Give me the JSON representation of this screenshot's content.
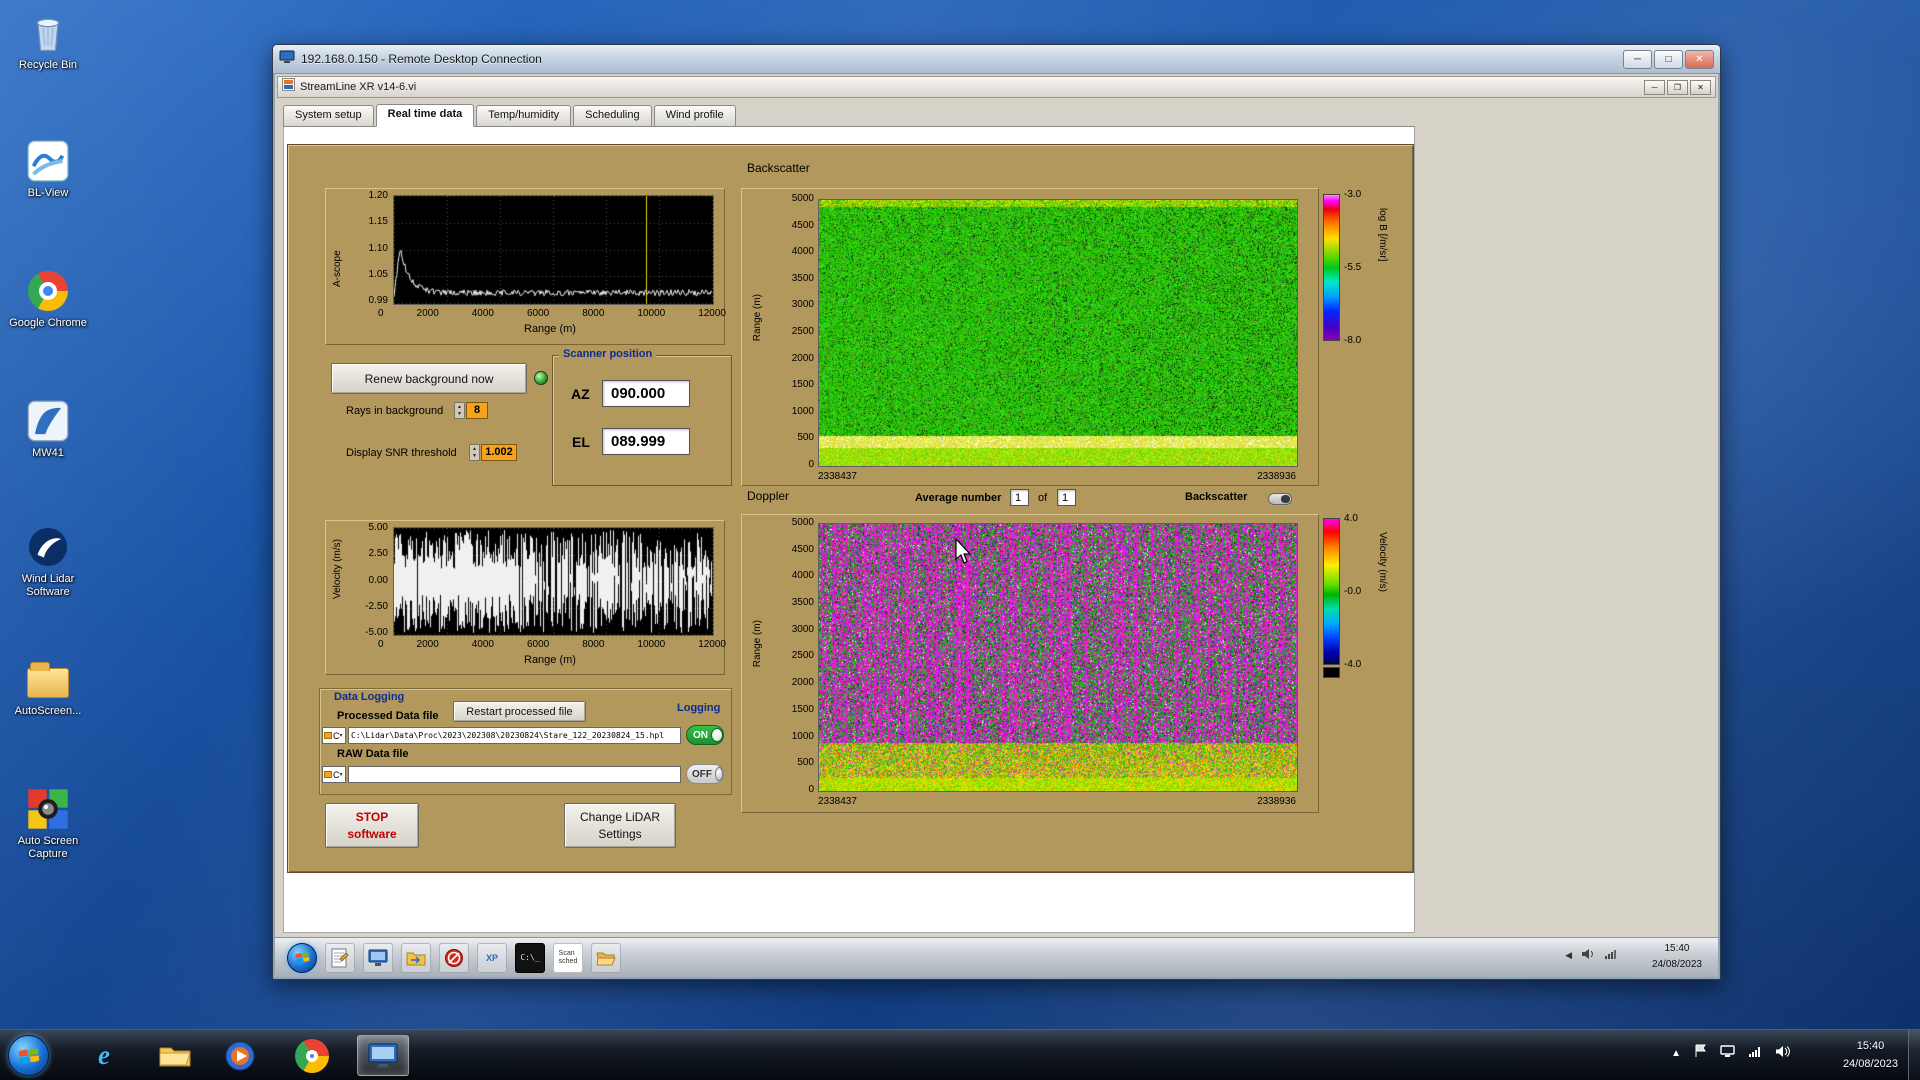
{
  "desktop": {
    "icons": [
      {
        "label": "Recycle Bin"
      },
      {
        "label": "BL-View"
      },
      {
        "label": "Google Chrome"
      },
      {
        "label": "MW41"
      },
      {
        "label": "Wind Lidar Software"
      },
      {
        "label": "AutoScreen..."
      },
      {
        "label": "Auto Screen Capture"
      }
    ]
  },
  "rdp": {
    "title": "192.168.0.150 - Remote Desktop Connection"
  },
  "app": {
    "title": "StreamLine XR v14-6.vi",
    "tabs": [
      {
        "label": "System setup"
      },
      {
        "label": "Real time data"
      },
      {
        "label": "Temp/humidity"
      },
      {
        "label": "Scheduling"
      },
      {
        "label": "Wind profile"
      }
    ]
  },
  "controls": {
    "renew_background": "Renew background now",
    "rays_label": "Rays in background",
    "rays_value": "8",
    "snr_label": "Display SNR threshold",
    "snr_value": "1.002",
    "scanner": {
      "title": "Scanner position",
      "az_label": "AZ",
      "az": "090.000",
      "el_label": "EL",
      "el": "089.999"
    },
    "average": {
      "label": "Average number",
      "value": "1",
      "of": "of",
      "value2": "1"
    },
    "backscatter_toggle_label": "Backscatter"
  },
  "plots": {
    "ascope": {
      "ylabel": "A-scope",
      "yticks": [
        "1.20",
        "1.15",
        "1.10",
        "1.05",
        "0.99"
      ],
      "xticks": [
        "0",
        "2000",
        "4000",
        "6000",
        "8000",
        "10000",
        "12000"
      ],
      "xlabel": "Range (m)"
    },
    "velocity_scope": {
      "ylabel": "Velocity (m/s)",
      "yticks": [
        "5.00",
        "2.50",
        "0.00",
        "-2.50",
        "-5.00"
      ],
      "xticks": [
        "0",
        "2000",
        "4000",
        "6000",
        "8000",
        "10000",
        "12000"
      ],
      "xlabel": "Range (m)"
    },
    "backscatter": {
      "title": "Backscatter",
      "ylabel": "Range (m)",
      "yticks": [
        "5000",
        "4500",
        "4000",
        "3500",
        "3000",
        "2500",
        "2000",
        "1500",
        "1000",
        "500",
        "0"
      ],
      "x_start": "2338437",
      "x_end": "2338936",
      "colorbar": {
        "ticks": [
          "-3.0",
          "-5.5",
          "-8.0"
        ],
        "label": "log B [/m/sr]"
      }
    },
    "doppler": {
      "title": "Doppler",
      "ylabel": "Range (m)",
      "yticks": [
        "5000",
        "4500",
        "4000",
        "3500",
        "3000",
        "2500",
        "2000",
        "1500",
        "1000",
        "500",
        "0"
      ],
      "x_start": "2338437",
      "x_end": "2338936",
      "colorbar": {
        "ticks": [
          "4.0",
          "-0.0",
          "-4.0"
        ],
        "label": "Velocity (m/s)"
      }
    }
  },
  "logging": {
    "section": "Data Logging",
    "processed_label": "Processed Data file",
    "restart_button": "Restart processed file",
    "logging_label": "Logging",
    "drive": "C",
    "processed_path": "C:\\Lidar\\Data\\Proc\\2023\\202308\\20230824\\Stare_122_20230824_15.hpl",
    "on": "ON",
    "raw_label": "RAW Data file",
    "raw_path": "",
    "off": "OFF"
  },
  "actions": {
    "stop_line1": "STOP",
    "stop_line2": "software",
    "settings_line1": "Change LiDAR",
    "settings_line2": "Settings"
  },
  "remote_taskbar": {
    "time": "15:40",
    "date": "24/08/2023",
    "scan_line1": "Scan",
    "scan_line2": "sched",
    "cmd_glyph": "C:\\_",
    "xp_glyph": "XP"
  },
  "host_taskbar": {
    "time": "15:40",
    "date": "24/08/2023"
  },
  "colors": {
    "panel": "#b2985c",
    "field_orange": "#f6a21d",
    "toggle_on_green": "#27b03c"
  }
}
